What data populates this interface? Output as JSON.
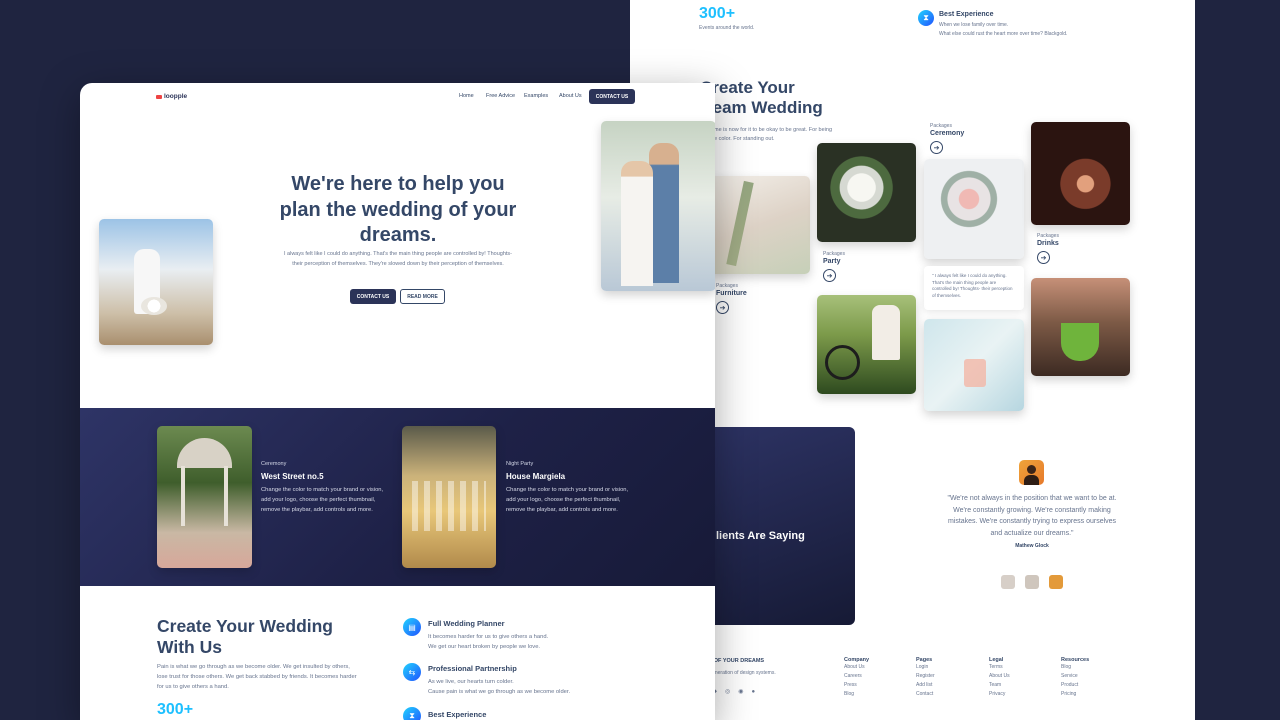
{
  "back": {
    "stat": {
      "number": "300+",
      "caption": "Events around the world."
    },
    "best": {
      "title": "Best Experience",
      "line1": "When we lose family over time.",
      "line2": "What else could rust the heart more over time? Blackgold."
    },
    "heading1": "Create Your",
    "heading2": "ream Wedding",
    "intro": "me is now for it to be okay to be great. For being\ne color. For standing out.",
    "packages": [
      {
        "small": "Packages",
        "title": "Ceremony"
      },
      {
        "small": "Packages",
        "title": "Party"
      },
      {
        "small": "Packages",
        "title": "Drinks"
      },
      {
        "small": "Packages",
        "title": "Furniture"
      }
    ],
    "arrow": "➔",
    "quote_card": "\" I always felt like I could do anything. That's the main thing people are controlled by! Thoughts- their perception of themselves.",
    "clients": "lients Are Saying",
    "testimonial": "\"We're not always in the position that we want to be at. We're constantly growing. We're constantly making mistakes. We're constantly trying to express ourselves and actualize our dreams.\"",
    "author": "Mathew Glock",
    "footer": {
      "brand": "NG OF YOUR DREAMS",
      "tagline": "xt generation of design systems.",
      "cols": [
        {
          "head": "Company",
          "items": [
            "About Us",
            "Careers",
            "Press",
            "Blog"
          ]
        },
        {
          "head": "Pages",
          "items": [
            "Login",
            "Register",
            "Add list",
            "Contact"
          ]
        },
        {
          "head": "Legal",
          "items": [
            "Terms",
            "About Us",
            "Team",
            "Privacy"
          ]
        },
        {
          "head": "Resources",
          "items": [
            "Blog",
            "Service",
            "Product",
            "Pricing"
          ]
        }
      ]
    }
  },
  "front": {
    "brand": "loopple",
    "nav": [
      "Home",
      "Free Advice",
      "Examples",
      "About Us"
    ],
    "nav_cta": "CONTACT US",
    "hero_title": "We're here to help you plan the wedding of your dreams.",
    "hero_text": "I always felt like I could do anything. That's the main thing people are controlled by! Thoughts- their perception of themselves. They're slowed down by their perception of themselves.",
    "btn_contact": "CONTACT US",
    "btn_more": "READ MORE",
    "events": [
      {
        "small": "Ceremony",
        "title": "West Street no.5",
        "text": "Change the color to match your brand or vision, add your logo, choose the perfect thumbnail, remove the playbar, add controls and more."
      },
      {
        "small": "Night Party",
        "title": "House Margiela",
        "text": "Change the color to match your brand or vision, add your logo, choose the perfect thumbnail, remove the playbar, add controls and more."
      }
    ],
    "create_title": "Create Your Wedding With Us",
    "create_text": "Pain is what we go through as we become older. We get insulted by others, lose trust for those others. We get back stabbed by friends. It becomes harder for us to give others a hand.",
    "stat": "300+",
    "features": [
      {
        "title": "Full Wedding Planner",
        "l1": "It becomes harder for us to give others a hand.",
        "l2": "We get our heart broken by people we love."
      },
      {
        "title": "Professional Partnership",
        "l1": "As we live, our hearts turn colder.",
        "l2": "Cause pain is what we go through as we become older."
      },
      {
        "title": "Best Experience",
        "l1": "",
        "l2": ""
      }
    ]
  },
  "colors": {
    "accent": "#2152ff",
    "stat": "#1ec0ff",
    "dark": "#2b3358",
    "text": "#344767"
  }
}
